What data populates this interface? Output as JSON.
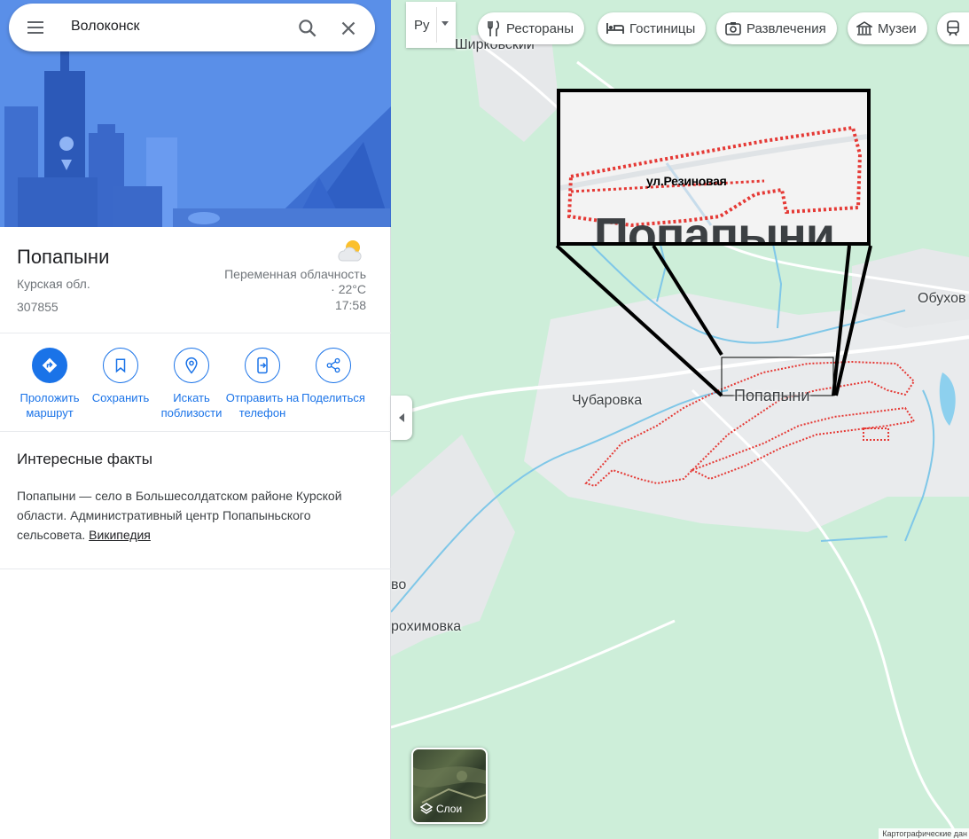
{
  "search": {
    "query": "Волоконск"
  },
  "place": {
    "title": "Попапыни",
    "region": "Курская обл.",
    "postal_code": "307855",
    "weather": {
      "condition": "Переменная облачность · 22°C",
      "time": "17:58",
      "icon": "partly-cloudy-icon"
    }
  },
  "actions": [
    {
      "label": "Проложить маршрут",
      "icon": "directions-icon"
    },
    {
      "label": "Сохранить",
      "icon": "bookmark-icon"
    },
    {
      "label": "Искать поблизости",
      "icon": "nearby-icon"
    },
    {
      "label": "Отправить на телефон",
      "icon": "send-to-phone-icon"
    },
    {
      "label": "Поделиться",
      "icon": "share-icon"
    }
  ],
  "facts": {
    "title": "Интересные факты",
    "text": "Попапыни — село в Большесолдатском районе Курской области. Административный центр Попапыньского сельсовета.",
    "link": "Википедия"
  },
  "map": {
    "language_button": "Ру",
    "chips": [
      {
        "label": "Рестораны",
        "icon": "restaurant-icon"
      },
      {
        "label": "Гостиницы",
        "icon": "hotel-icon"
      },
      {
        "label": "Развлечения",
        "icon": "camera-icon"
      },
      {
        "label": "Музеи",
        "icon": "museum-icon"
      }
    ],
    "labels": {
      "shirkovsky": "Ширковский",
      "obukhov": "Обухов",
      "chubarovka": "Чубаровка",
      "popapyni": "Попапыни",
      "vo": "во",
      "rokhimovka": "рохимовка"
    },
    "zoom_inset": {
      "street": "ул.Резиновая",
      "town": "Попапыни"
    },
    "layers_label": "Слои",
    "attribution": "Картографические дан"
  }
}
